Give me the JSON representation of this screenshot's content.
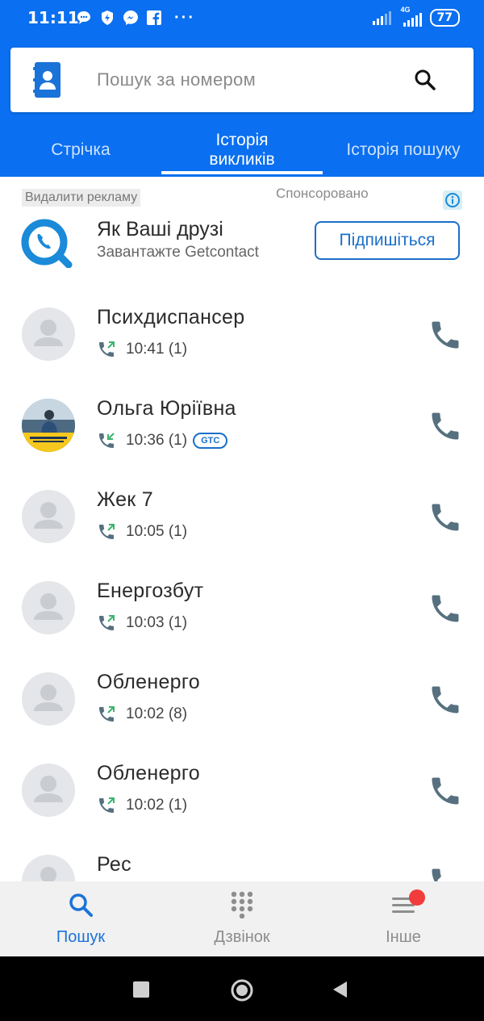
{
  "status_bar": {
    "time": "11:11",
    "network": "4G",
    "battery": "77"
  },
  "search": {
    "placeholder": "Пошук за номером"
  },
  "tabs": [
    {
      "label": "Стрічка"
    },
    {
      "label_line1": "Історія",
      "label_line2": "викликів"
    },
    {
      "label": "Історія пошуку"
    }
  ],
  "ad": {
    "remove_label": "Видалити рекламу",
    "sponsored_label": "Спонсоровано",
    "title": "Як Ваші друзі",
    "subtitle": "Завантажте Getcontact",
    "cta": "Підпишіться"
  },
  "calls": [
    {
      "name": "Психдиспансер",
      "time": "10:41",
      "count": "(1)",
      "direction": "outgoing"
    },
    {
      "name": "Ольга Юріївна",
      "time": "10:36",
      "count": "(1)",
      "direction": "incoming",
      "badge": "GTC"
    },
    {
      "name": "Жек 7",
      "time": "10:05",
      "count": "(1)",
      "direction": "outgoing"
    },
    {
      "name": "Енергозбут",
      "time": "10:03",
      "count": "(1)",
      "direction": "outgoing"
    },
    {
      "name": "Обленерго",
      "time": "10:02",
      "count": "(8)",
      "direction": "outgoing"
    },
    {
      "name": "Обленерго",
      "time": "10:02",
      "count": "(1)",
      "direction": "outgoing"
    },
    {
      "name": "Рес",
      "time": "",
      "count": "",
      "direction": "outgoing"
    }
  ],
  "bottom_nav": [
    {
      "label": "Пошук",
      "icon": "search-icon",
      "active": true
    },
    {
      "label": "Дзвінок",
      "icon": "dialpad-icon",
      "active": false
    },
    {
      "label": "Інше",
      "icon": "menu-icon",
      "active": false
    }
  ],
  "colors": {
    "primary": "#0a6ff0",
    "accent": "#1a73d9",
    "icon_gray": "#56707f",
    "badge_red": "#f23b3b"
  }
}
